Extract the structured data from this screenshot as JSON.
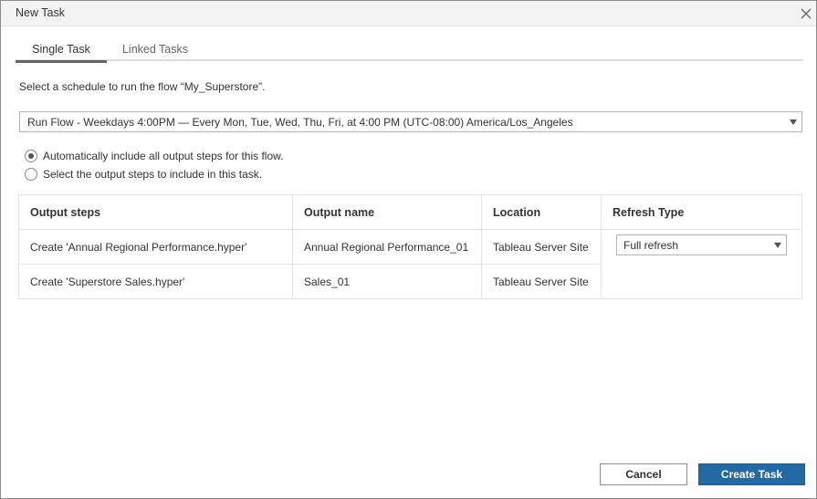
{
  "dialog": {
    "title": "New Task",
    "close_icon": "close-icon"
  },
  "tabs": [
    {
      "label": "Single Task",
      "active": true
    },
    {
      "label": "Linked Tasks",
      "active": false
    }
  ],
  "instructions": "Select a schedule to run the flow “My_Superstore”.",
  "schedule": {
    "selected": "Run Flow - Weekdays 4:00PM — Every Mon, Tue, Wed, Thu, Fri, at 4:00 PM (UTC-08:00) America/Los_Angeles"
  },
  "options": [
    {
      "label": "Automatically include all output steps for this flow.",
      "checked": true
    },
    {
      "label": "Select the output steps to include in this task.",
      "checked": false
    }
  ],
  "table": {
    "headers": [
      "Output steps",
      "Output name",
      "Location",
      "Refresh Type"
    ],
    "rows": [
      {
        "output_step": "Create 'Annual Regional Performance.hyper'",
        "output_name": "Annual Regional Performance_01",
        "location": "Tableau Server Site"
      },
      {
        "output_step": "Create 'Superstore Sales.hyper'",
        "output_name": "Sales_01",
        "location": "Tableau Server Site"
      }
    ],
    "refresh_type": "Full refresh"
  },
  "buttons": {
    "cancel": "Cancel",
    "create": "Create Task"
  },
  "colors": {
    "primary": "#2369a3",
    "border": "#e3e3e3"
  }
}
